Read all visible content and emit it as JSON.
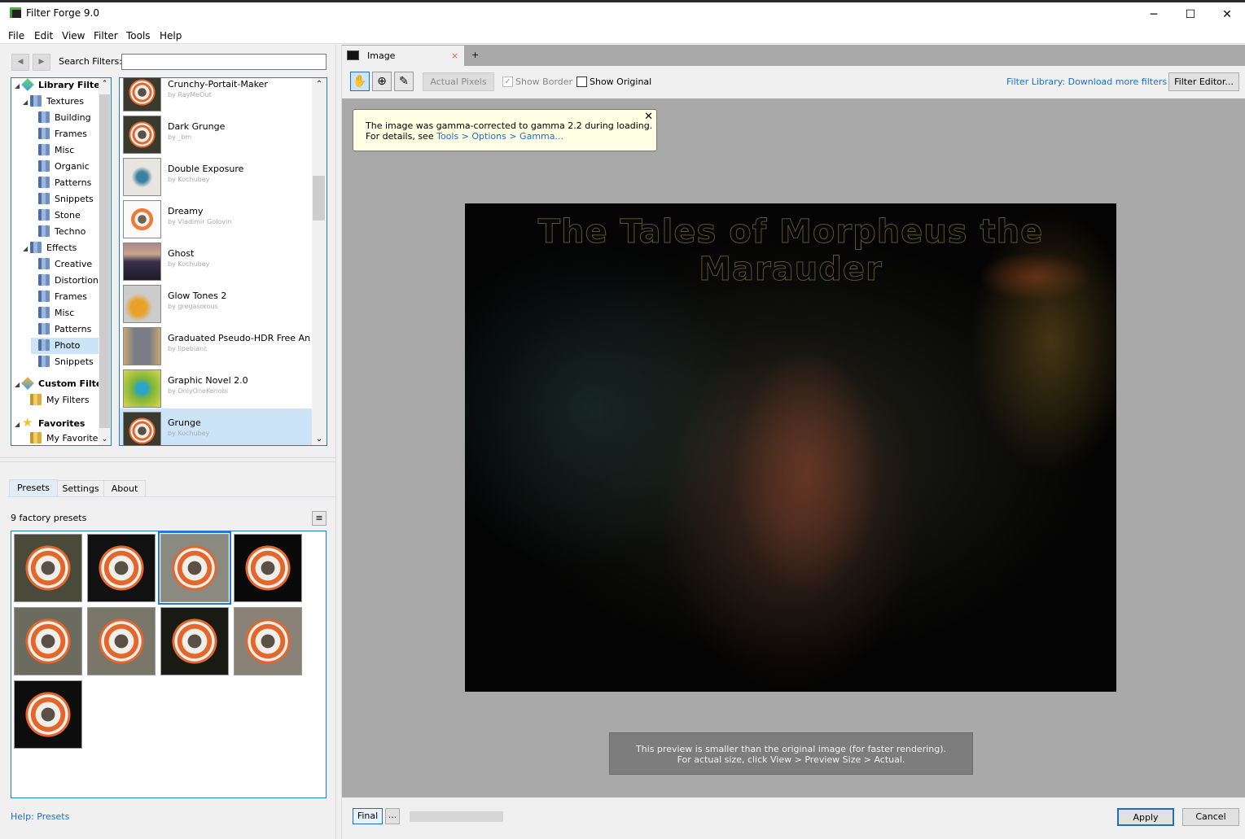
{
  "window": {
    "title": "Filter Forge 9.0",
    "minimize": "─",
    "maximize": "☐",
    "close": "✕"
  },
  "menu": [
    "File",
    "Edit",
    "View",
    "Filter",
    "Tools",
    "Help"
  ],
  "left": {
    "back": "◀",
    "forward": "▶",
    "search_label": "Search Filters:",
    "search_value": "",
    "tree": [
      {
        "label": "Library Filters",
        "level": 0,
        "icon": "library-cube-icon",
        "bold": true,
        "expanded": true
      },
      {
        "label": "Textures",
        "level": 1,
        "icon": "folder-icon",
        "expanded": true
      },
      {
        "label": "Building",
        "level": 2,
        "icon": "folder-icon"
      },
      {
        "label": "Frames",
        "level": 2,
        "icon": "folder-icon"
      },
      {
        "label": "Misc",
        "level": 2,
        "icon": "folder-icon"
      },
      {
        "label": "Organic",
        "level": 2,
        "icon": "folder-icon"
      },
      {
        "label": "Patterns",
        "level": 2,
        "icon": "folder-icon"
      },
      {
        "label": "Snippets",
        "level": 2,
        "icon": "folder-icon"
      },
      {
        "label": "Stone",
        "level": 2,
        "icon": "folder-icon"
      },
      {
        "label": "Techno",
        "level": 2,
        "icon": "folder-icon"
      },
      {
        "label": "Effects",
        "level": 1,
        "icon": "folder-icon",
        "expanded": true
      },
      {
        "label": "Creative",
        "level": 2,
        "icon": "folder-icon"
      },
      {
        "label": "Distortion",
        "level": 2,
        "icon": "folder-icon"
      },
      {
        "label": "Frames",
        "level": 2,
        "icon": "folder-icon"
      },
      {
        "label": "Misc",
        "level": 2,
        "icon": "folder-icon"
      },
      {
        "label": "Patterns",
        "level": 2,
        "icon": "folder-icon"
      },
      {
        "label": "Photo",
        "level": 2,
        "icon": "folder-icon",
        "selected": true
      },
      {
        "label": "Snippets",
        "level": 2,
        "icon": "folder-icon"
      },
      {
        "label": "Custom Filters",
        "level": 0,
        "icon": "custom-cube-icon",
        "bold": true,
        "expanded": true
      },
      {
        "label": "My Filters",
        "level": 1,
        "icon": "folder-icon"
      },
      {
        "label": "Favorites",
        "level": 0,
        "icon": "star-icon",
        "bold": true,
        "expanded": true
      },
      {
        "label": "My Favorites",
        "level": 1,
        "icon": "folder-icon"
      }
    ],
    "filters": [
      {
        "name": "Crunchy-Portait-Maker",
        "author": "by RayMeOut"
      },
      {
        "name": "Dark Grunge",
        "author": "by _bm"
      },
      {
        "name": "Double Exposure",
        "author": "by Kochubey"
      },
      {
        "name": "Dreamy",
        "author": "by Vladimir Golovin"
      },
      {
        "name": "Ghost",
        "author": "by Kochubey"
      },
      {
        "name": "Glow Tones 2",
        "author": "by gregasorous"
      },
      {
        "name": "Graduated Pseudo-HDR Free An...",
        "author": "by lipebianc"
      },
      {
        "name": "Graphic Novel 2.0",
        "author": "by OnlyOneKenobi"
      },
      {
        "name": "Grunge",
        "author": "by Kochubey",
        "selected": true
      }
    ],
    "tabs": [
      "Presets",
      "Settings",
      "About"
    ],
    "active_tab": "Presets",
    "preset_count": "9 factory presets",
    "preset_selected": 3,
    "preset_total": 9,
    "help": "Help: Presets"
  },
  "right": {
    "tab": "Image",
    "tab_close": "×",
    "tab_add": "+",
    "tools": [
      {
        "name": "hand-tool",
        "glyph": "✋"
      },
      {
        "name": "zoom-tool",
        "glyph": "🔍"
      },
      {
        "name": "eyedropper-tool",
        "glyph": "✎"
      }
    ],
    "actual_pixels": "Actual Pixels",
    "show_border": "Show Border",
    "show_border_checked": true,
    "show_original": "Show Original",
    "show_original_checked": false,
    "library_link": "Filter Library: Download more filters",
    "filter_editor": "Filter Editor...",
    "notice": {
      "line1": "The image was gamma-corrected to gamma 2.2 during loading.",
      "line2_prefix": "For details, see ",
      "line2_link": "Tools > Options > Gamma...",
      "close": "✕"
    },
    "preview_title": "The Tales of Morpheus the Marauder",
    "preview_note": {
      "line1": "This preview is smaller than the original image (for faster rendering).",
      "line2": "For actual size, click View > Preview Size > Actual."
    },
    "final": "Final",
    "more": "...",
    "apply": "Apply",
    "cancel": "Cancel",
    "progress": 0
  }
}
